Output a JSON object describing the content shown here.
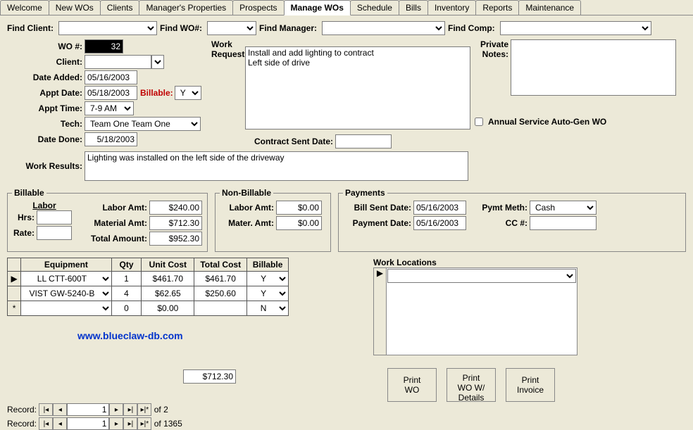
{
  "tabs": [
    "Welcome",
    "New WOs",
    "Clients",
    "Manager's Properties",
    "Prospects",
    "Manage WOs",
    "Schedule",
    "Bills",
    "Inventory",
    "Reports",
    "Maintenance"
  ],
  "activeTab": "Manage WOs",
  "find": {
    "client_lbl": "Find Client:",
    "client_val": "",
    "wo_lbl": "Find WO#:",
    "wo_val": "",
    "mgr_lbl": "Find Manager:",
    "mgr_val": "",
    "comp_lbl": "Find Comp:",
    "comp_val": ""
  },
  "wo": {
    "wo_num_lbl": "WO #:",
    "wo_num": "32",
    "client_lbl": "Client:",
    "client": "",
    "date_added_lbl": "Date Added:",
    "date_added": "05/16/2003",
    "appt_date_lbl": "Appt Date:",
    "appt_date": "05/18/2003",
    "billable_lbl": "Billable:",
    "billable": "Y",
    "appt_time_lbl": "Appt Time:",
    "appt_time": "7-9 AM",
    "tech_lbl": "Tech:",
    "tech": "Team One Team One",
    "date_done_lbl": "Date Done:",
    "date_done": "5/18/2003",
    "work_req_lbl": "Work Requested:",
    "work_req": "Install and add lighting to contract\nLeft side of drive",
    "private_notes_lbl": "Private\nNotes:",
    "private_notes": "",
    "contract_sent_lbl": "Contract Sent Date:",
    "contract_sent": "",
    "annual_lbl": "Annual Service Auto-Gen WO",
    "work_results_lbl": "Work Results:",
    "work_results": "Lighting was installed on the left side of the driveway"
  },
  "billable": {
    "legend": "Billable",
    "labor_u": "Labor",
    "hrs_lbl": "Hrs:",
    "hrs": "",
    "rate_lbl": "Rate:",
    "rate": "",
    "labor_amt_lbl": "Labor Amt:",
    "labor_amt": "$240.00",
    "material_amt_lbl": "Material Amt:",
    "material_amt": "$712.30",
    "total_amt_lbl": "Total Amount:",
    "total_amt": "$952.30"
  },
  "nonbillable": {
    "legend": "Non-Billable",
    "labor_amt_lbl": "Labor Amt:",
    "labor_amt": "$0.00",
    "mater_amt_lbl": "Mater. Amt:",
    "mater_amt": "$0.00"
  },
  "payments": {
    "legend": "Payments",
    "bill_sent_lbl": "Bill Sent Date:",
    "bill_sent": "05/16/2003",
    "pay_date_lbl": "Payment Date:",
    "pay_date": "05/16/2003",
    "pymt_meth_lbl": "Pymt Meth:",
    "pymt_meth": "Cash",
    "cc_lbl": "CC #:",
    "cc": ""
  },
  "equip": {
    "hdr_equipment": "Equipment",
    "hdr_qty": "Qty",
    "hdr_unitcost": "Unit Cost",
    "hdr_totalcost": "Total Cost",
    "hdr_billable": "Billable",
    "rows": [
      {
        "sel": "▶",
        "name": "LL CTT-600T",
        "qty": "1",
        "unit": "$461.70",
        "total": "$461.70",
        "bill": "Y"
      },
      {
        "sel": "",
        "name": "VIST GW-5240-B",
        "qty": "4",
        "unit": "$62.65",
        "total": "$250.60",
        "bill": "Y"
      },
      {
        "sel": "*",
        "name": "",
        "qty": "0",
        "unit": "$0.00",
        "total": "",
        "bill": "N"
      }
    ],
    "sum": "$712.30"
  },
  "work_locations_lbl": "Work Locations",
  "work_loc_sel": "▶",
  "buttons": {
    "print_wo": "Print\nWO",
    "print_wo_details": "Print\nWO W/\nDetails",
    "print_invoice": "Print\nInvoice"
  },
  "link": "www.blueclaw-db.com",
  "nav": {
    "rec_lbl": "Record:",
    "first": "|◂",
    "prev": "◂",
    "next": "▸",
    "last": "▸|",
    "new": "▸|*",
    "pos1": "1",
    "of": "of",
    "total1": "2",
    "total2": "1365"
  }
}
